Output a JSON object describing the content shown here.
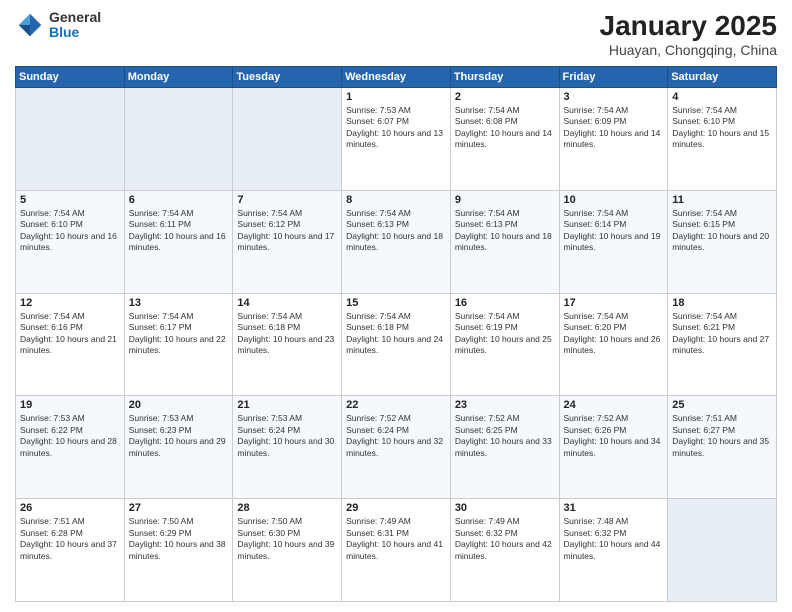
{
  "header": {
    "logo_general": "General",
    "logo_blue": "Blue",
    "title": "January 2025",
    "location": "Huayan, Chongqing, China"
  },
  "weekdays": [
    "Sunday",
    "Monday",
    "Tuesday",
    "Wednesday",
    "Thursday",
    "Friday",
    "Saturday"
  ],
  "weeks": [
    [
      {
        "day": "",
        "empty": true
      },
      {
        "day": "",
        "empty": true
      },
      {
        "day": "",
        "empty": true
      },
      {
        "day": "1",
        "sunrise": "7:53 AM",
        "sunset": "6:07 PM",
        "daylight": "10 hours and 13 minutes."
      },
      {
        "day": "2",
        "sunrise": "7:54 AM",
        "sunset": "6:08 PM",
        "daylight": "10 hours and 14 minutes."
      },
      {
        "day": "3",
        "sunrise": "7:54 AM",
        "sunset": "6:09 PM",
        "daylight": "10 hours and 14 minutes."
      },
      {
        "day": "4",
        "sunrise": "7:54 AM",
        "sunset": "6:10 PM",
        "daylight": "10 hours and 15 minutes."
      }
    ],
    [
      {
        "day": "5",
        "sunrise": "7:54 AM",
        "sunset": "6:10 PM",
        "daylight": "10 hours and 16 minutes."
      },
      {
        "day": "6",
        "sunrise": "7:54 AM",
        "sunset": "6:11 PM",
        "daylight": "10 hours and 16 minutes."
      },
      {
        "day": "7",
        "sunrise": "7:54 AM",
        "sunset": "6:12 PM",
        "daylight": "10 hours and 17 minutes."
      },
      {
        "day": "8",
        "sunrise": "7:54 AM",
        "sunset": "6:13 PM",
        "daylight": "10 hours and 18 minutes."
      },
      {
        "day": "9",
        "sunrise": "7:54 AM",
        "sunset": "6:13 PM",
        "daylight": "10 hours and 18 minutes."
      },
      {
        "day": "10",
        "sunrise": "7:54 AM",
        "sunset": "6:14 PM",
        "daylight": "10 hours and 19 minutes."
      },
      {
        "day": "11",
        "sunrise": "7:54 AM",
        "sunset": "6:15 PM",
        "daylight": "10 hours and 20 minutes."
      }
    ],
    [
      {
        "day": "12",
        "sunrise": "7:54 AM",
        "sunset": "6:16 PM",
        "daylight": "10 hours and 21 minutes."
      },
      {
        "day": "13",
        "sunrise": "7:54 AM",
        "sunset": "6:17 PM",
        "daylight": "10 hours and 22 minutes."
      },
      {
        "day": "14",
        "sunrise": "7:54 AM",
        "sunset": "6:18 PM",
        "daylight": "10 hours and 23 minutes."
      },
      {
        "day": "15",
        "sunrise": "7:54 AM",
        "sunset": "6:18 PM",
        "daylight": "10 hours and 24 minutes."
      },
      {
        "day": "16",
        "sunrise": "7:54 AM",
        "sunset": "6:19 PM",
        "daylight": "10 hours and 25 minutes."
      },
      {
        "day": "17",
        "sunrise": "7:54 AM",
        "sunset": "6:20 PM",
        "daylight": "10 hours and 26 minutes."
      },
      {
        "day": "18",
        "sunrise": "7:54 AM",
        "sunset": "6:21 PM",
        "daylight": "10 hours and 27 minutes."
      }
    ],
    [
      {
        "day": "19",
        "sunrise": "7:53 AM",
        "sunset": "6:22 PM",
        "daylight": "10 hours and 28 minutes."
      },
      {
        "day": "20",
        "sunrise": "7:53 AM",
        "sunset": "6:23 PM",
        "daylight": "10 hours and 29 minutes."
      },
      {
        "day": "21",
        "sunrise": "7:53 AM",
        "sunset": "6:24 PM",
        "daylight": "10 hours and 30 minutes."
      },
      {
        "day": "22",
        "sunrise": "7:52 AM",
        "sunset": "6:24 PM",
        "daylight": "10 hours and 32 minutes."
      },
      {
        "day": "23",
        "sunrise": "7:52 AM",
        "sunset": "6:25 PM",
        "daylight": "10 hours and 33 minutes."
      },
      {
        "day": "24",
        "sunrise": "7:52 AM",
        "sunset": "6:26 PM",
        "daylight": "10 hours and 34 minutes."
      },
      {
        "day": "25",
        "sunrise": "7:51 AM",
        "sunset": "6:27 PM",
        "daylight": "10 hours and 35 minutes."
      }
    ],
    [
      {
        "day": "26",
        "sunrise": "7:51 AM",
        "sunset": "6:28 PM",
        "daylight": "10 hours and 37 minutes."
      },
      {
        "day": "27",
        "sunrise": "7:50 AM",
        "sunset": "6:29 PM",
        "daylight": "10 hours and 38 minutes."
      },
      {
        "day": "28",
        "sunrise": "7:50 AM",
        "sunset": "6:30 PM",
        "daylight": "10 hours and 39 minutes."
      },
      {
        "day": "29",
        "sunrise": "7:49 AM",
        "sunset": "6:31 PM",
        "daylight": "10 hours and 41 minutes."
      },
      {
        "day": "30",
        "sunrise": "7:49 AM",
        "sunset": "6:32 PM",
        "daylight": "10 hours and 42 minutes."
      },
      {
        "day": "31",
        "sunrise": "7:48 AM",
        "sunset": "6:32 PM",
        "daylight": "10 hours and 44 minutes."
      },
      {
        "day": "",
        "empty": true
      }
    ]
  ]
}
